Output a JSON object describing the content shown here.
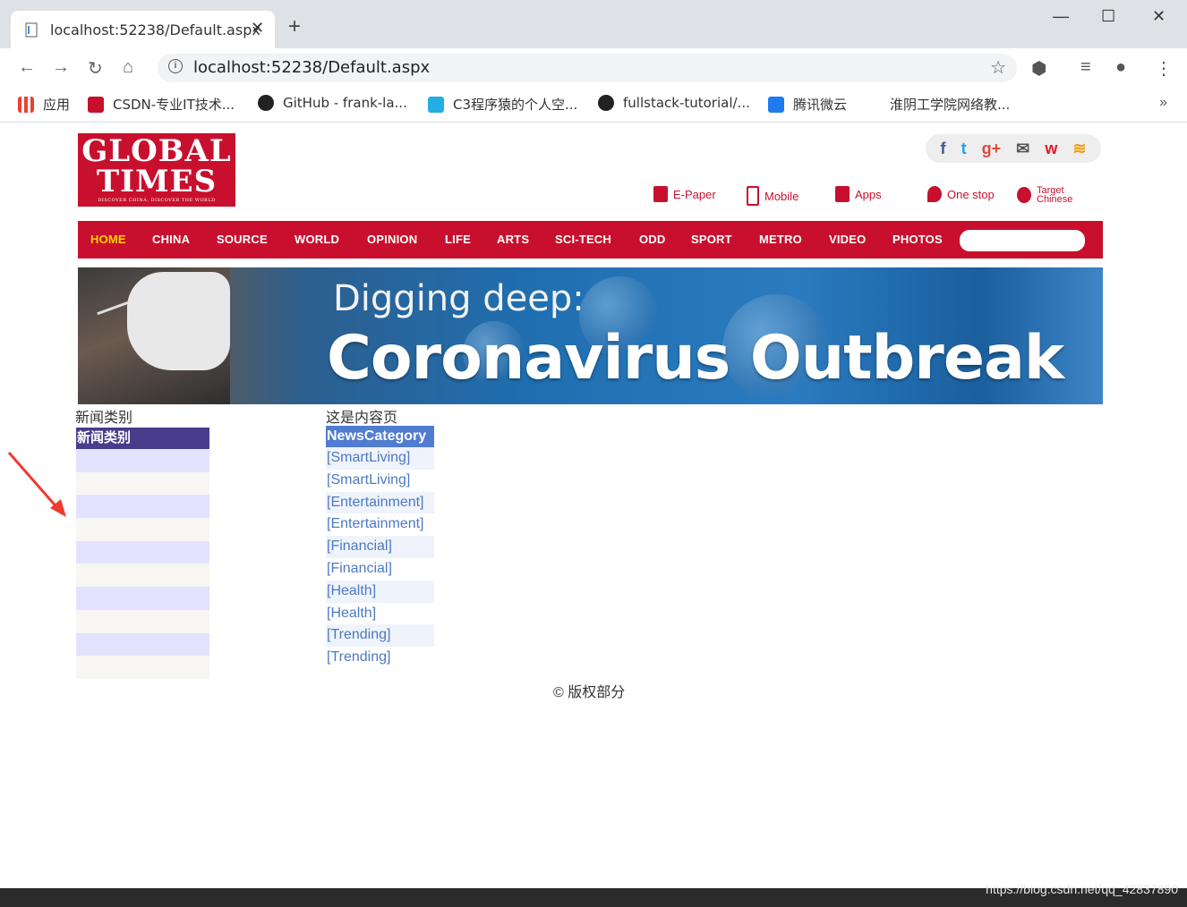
{
  "browser": {
    "tab_title": "localhost:52238/Default.aspx",
    "tab_close": "✕",
    "new_tab": "+",
    "url": "localhost:52238/Default.aspx",
    "bookmarks": [
      {
        "label": "应用",
        "color": "#e94235"
      },
      {
        "label": "CSDN-专业IT技术...",
        "color": "#c8102e"
      },
      {
        "label": "GitHub - frank-la...",
        "color": "#222222"
      },
      {
        "label": "C3程序猿的个人空...",
        "color": "#23ade5"
      },
      {
        "label": "fullstack-tutorial/...",
        "color": "#222222"
      },
      {
        "label": "腾讯微云",
        "color": "#1f7cf0"
      },
      {
        "label": "淮阴工学院网络教...",
        "color": "#ffffff"
      }
    ],
    "bookmarks_more": "»"
  },
  "site": {
    "logo_line1": "GLOBAL",
    "logo_line2": "TIMES",
    "logo_tagline": "DISCOVER CHINA, DISCOVER THE WORLD",
    "social": [
      "f",
      "t",
      "g+",
      "✉",
      "w",
      "rss"
    ],
    "services": [
      {
        "label": "E-Paper"
      },
      {
        "label": "Mobile"
      },
      {
        "label": "Apps"
      },
      {
        "label": "One stop"
      },
      {
        "label": "Target Chinese"
      }
    ],
    "nav": [
      "HOME",
      "CHINA",
      "SOURCE",
      "WORLD",
      "OPINION",
      "LIFE",
      "ARTS",
      "SCI-TECH",
      "ODD",
      "SPORT",
      "METRO",
      "VIDEO",
      "PHOTOS"
    ],
    "banner_small": "Digging deep:",
    "banner_big": "Coronavirus Outbreak"
  },
  "main": {
    "category_label": "新闻类别",
    "content_label": "这是内容页",
    "left_grid_header": "新闻类别",
    "right_grid_header": "NewsCategory",
    "right_grid_rows": [
      "[SmartLiving]",
      "[SmartLiving]",
      "[Entertainment]",
      "[Entertainment]",
      "[Financial]",
      "[Financial]",
      "[Health]",
      "[Health]",
      "[Trending]",
      "[Trending]"
    ],
    "footer": "© 版权部分"
  },
  "watermark": "https://blog.csdn.net/qq_42837890",
  "colors": {
    "brand_red": "#c8102e",
    "nav_active": "#ffd200",
    "grid_left_header": "#4a3c8c",
    "grid_right_header": "#507cd1",
    "link": "#4c7ac0"
  }
}
